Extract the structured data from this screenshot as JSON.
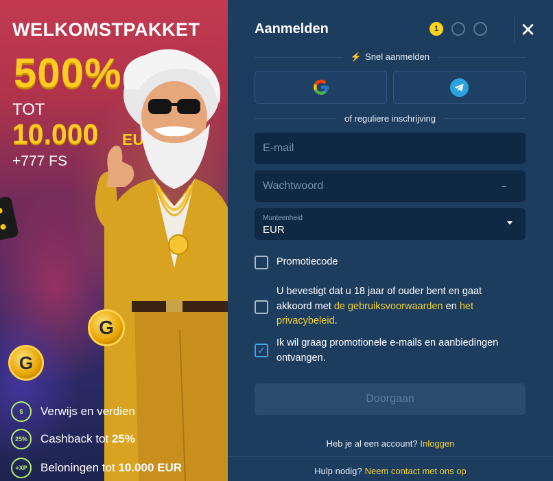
{
  "promo": {
    "title": "WELKOMSTPAKKET",
    "percent": "500%",
    "tot": "TOT",
    "amount": "10.000",
    "currency": "EURO",
    "free_spins": "+777 FS",
    "benefits": [
      {
        "text": "Verwijs en verdien",
        "bold": "",
        "icon_text": "$"
      },
      {
        "text": "Cashback tot ",
        "bold": "25%",
        "icon_text": "25%"
      },
      {
        "text": "Beloningen tot ",
        "bold": "10.000 EUR",
        "icon_text": "+XP"
      }
    ]
  },
  "form": {
    "title": "Aanmelden",
    "steps": [
      "1",
      "",
      ""
    ],
    "active_step": 1,
    "quick_signup_label": "Snel aanmelden",
    "regular_signup_label": "of reguliere inschrijving",
    "email_placeholder": "E-mail",
    "password_placeholder": "Wachtwoord",
    "currency_label": "Munteenheid",
    "currency_value": "EUR",
    "promo_code_label": "Promotiecode",
    "terms": {
      "prefix": "U bevestigt dat u 18 jaar of ouder bent en gaat akkoord met ",
      "terms_link": "de gebruiksvoorwaarden",
      "middle": " en ",
      "privacy_link": "het privacybeleid",
      "suffix": "."
    },
    "marketing_label": "Ik wil graag promotionele e-mails en aanbiedingen ontvangen.",
    "marketing_checked": true,
    "submit_label": "Doorgaan",
    "have_account_text": "Heb je al een account?",
    "login_link": "Inloggen",
    "help_text": "Hulp nodig?",
    "contact_link": "Neem contact met ons op"
  },
  "colors": {
    "accent_yellow": "#ffcc1f",
    "link_yellow": "#f3d033",
    "panel_bg": "#1d3d5f",
    "field_bg": "#0f2844",
    "checkbox_blue": "#42a5e8"
  }
}
